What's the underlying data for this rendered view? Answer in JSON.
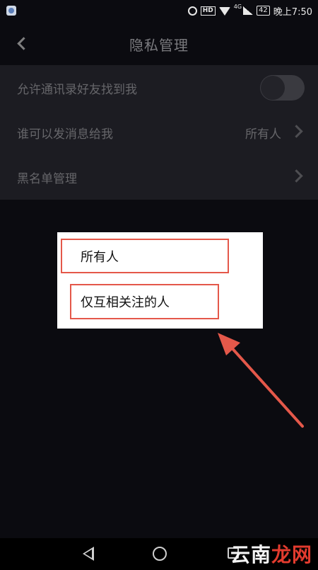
{
  "statusbar": {
    "network_label": "4G",
    "hd_label": "HD",
    "battery": "42",
    "time": "晚上7:50"
  },
  "header": {
    "title": "隐私管理"
  },
  "settings": {
    "contacts_toggle_label": "允许通讯录好友找到我",
    "contacts_toggle_on": false,
    "message_permission_label": "谁可以发消息给我",
    "message_permission_value": "所有人",
    "blacklist_label": "黑名单管理"
  },
  "popup": {
    "options": [
      "所有人",
      "仅互相关注的人"
    ]
  },
  "annotation": {
    "color": "#e4584a"
  },
  "watermark": {
    "part1": "云南",
    "part2": "龙网"
  },
  "colors": {
    "background": "#0b0b10",
    "list_background": "#1c1c22",
    "highlight": "#e4584a"
  }
}
